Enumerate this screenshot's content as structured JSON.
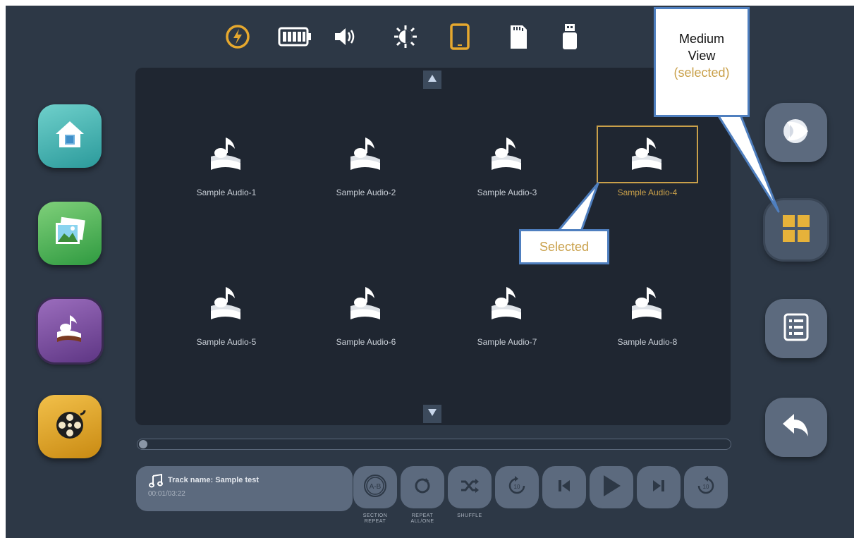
{
  "status_bar": {
    "icons": [
      "charging-icon",
      "battery-icon",
      "volume-icon",
      "brightness-icon",
      "tablet-icon",
      "sd-card-icon",
      "usb-drive-icon"
    ],
    "active_color": "#e6a82e"
  },
  "nav": {
    "items": [
      "home-icon",
      "gallery-icon",
      "music-icon",
      "video-icon"
    ]
  },
  "grid": {
    "items": [
      {
        "label": "Sample Audio-1"
      },
      {
        "label": "Sample Audio-2"
      },
      {
        "label": "Sample Audio-3"
      },
      {
        "label": "Sample Audio-4",
        "selected": true
      },
      {
        "label": "Sample Audio-5"
      },
      {
        "label": "Sample Audio-6"
      },
      {
        "label": "Sample Audio-7"
      },
      {
        "label": "Sample Audio-8"
      }
    ]
  },
  "side_buttons": [
    "playback-icon",
    "medium-view-icon",
    "list-view-icon",
    "back-icon"
  ],
  "player": {
    "track_name": "Track name: Sample test",
    "time": "00:01/03:22",
    "progress": 0.0,
    "labels": {
      "section_repeat": "SECTION REPEAT",
      "repeat_all_one": "REPEAT ALL/ONE",
      "shuffle": "SHUFFLE"
    }
  },
  "callouts": {
    "medium_view_title": "Medium View",
    "medium_view_state": "(selected)",
    "selected": "Selected"
  },
  "colors": {
    "accent": "#c9a04a",
    "panel": "#1f2631",
    "background": "#2d3846",
    "callout_border": "#4f7fbf"
  }
}
